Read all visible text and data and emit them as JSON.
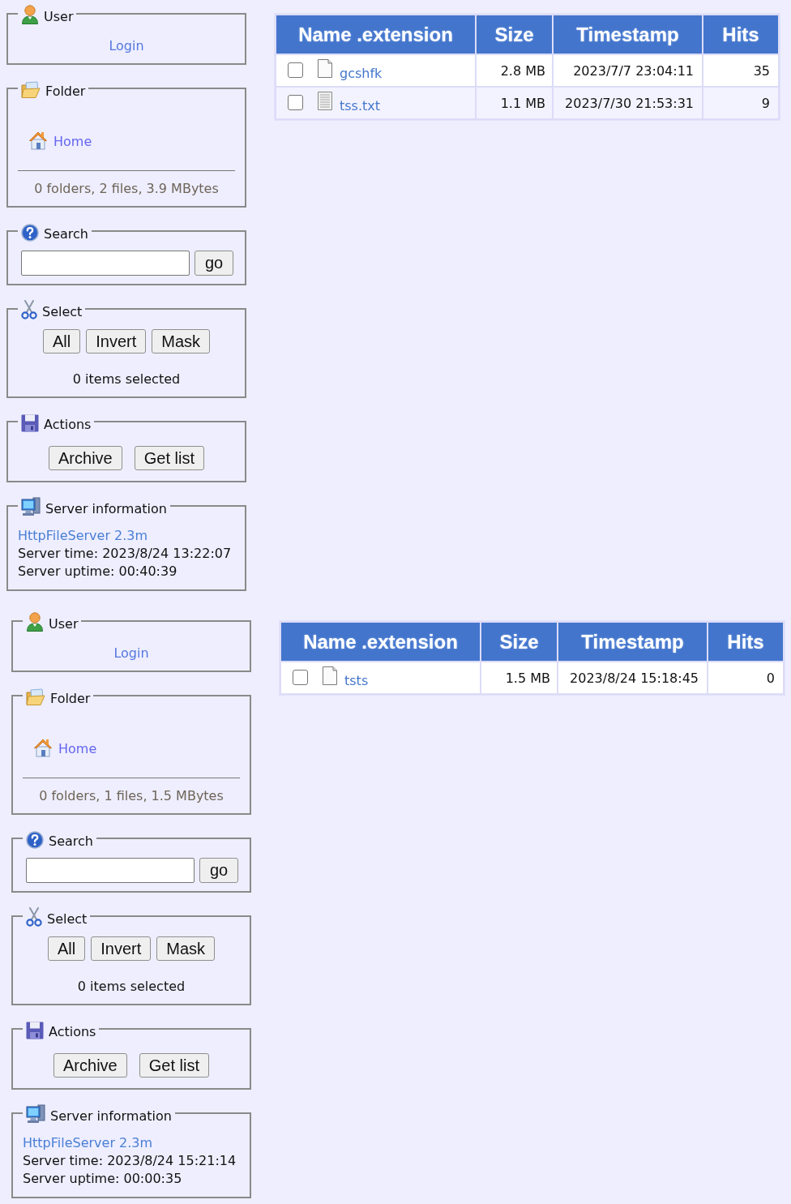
{
  "pages": [
    {
      "sidebar": [
        {
          "kind": "user",
          "title": "User",
          "link": "Login"
        },
        {
          "kind": "folder",
          "title": "Folder",
          "link": "Home",
          "summary": "0 folders, 2 files, 3.9 MBytes"
        },
        {
          "kind": "search",
          "title": "Search",
          "button": "go"
        },
        {
          "kind": "select",
          "title": "Select",
          "buttons": [
            "All",
            "Invert",
            "Mask"
          ],
          "summary": "0 items selected"
        },
        {
          "kind": "actions",
          "title": "Actions",
          "buttons": [
            "Archive",
            "Get list"
          ]
        },
        {
          "kind": "server",
          "title": "Server information",
          "link": "HttpFileServer 2.3m",
          "lines": [
            "Server time: 2023/8/24 13:22:07",
            "Server uptime: 00:40:39"
          ]
        }
      ],
      "table": {
        "columns": [
          "Name .extension",
          "Size",
          "Timestamp",
          "Hits"
        ],
        "rows": [
          {
            "checked": false,
            "kind": "file",
            "name": "gcshfk",
            "size": "2.8 MB",
            "timestamp": "2023/7/7 23:04:11",
            "hits": "35"
          },
          {
            "checked": false,
            "kind": "text",
            "name": "tss.txt",
            "size": "1.1 MB",
            "timestamp": "2023/7/30 21:53:31",
            "hits": "9"
          }
        ]
      }
    },
    {
      "sidebar": [
        {
          "kind": "user",
          "title": "User",
          "link": "Login"
        },
        {
          "kind": "folder",
          "title": "Folder",
          "link": "Home",
          "summary": "0 folders, 1 files, 1.5 MBytes"
        },
        {
          "kind": "search",
          "title": "Search",
          "button": "go"
        },
        {
          "kind": "select",
          "title": "Select",
          "buttons": [
            "All",
            "Invert",
            "Mask"
          ],
          "summary": "0 items selected"
        },
        {
          "kind": "actions",
          "title": "Actions",
          "buttons": [
            "Archive",
            "Get list"
          ]
        },
        {
          "kind": "server",
          "title": "Server information",
          "link": "HttpFileServer 2.3m",
          "lines": [
            "Server time: 2023/8/24 15:21:14",
            "Server uptime: 00:00:35"
          ]
        }
      ],
      "table": {
        "columns": [
          "Name .extension",
          "Size",
          "Timestamp",
          "Hits"
        ],
        "rows": [
          {
            "checked": false,
            "kind": "file",
            "name": "tsts",
            "size": "1.5 MB",
            "timestamp": "2023/8/24 15:18:45",
            "hits": "0"
          }
        ]
      }
    }
  ]
}
